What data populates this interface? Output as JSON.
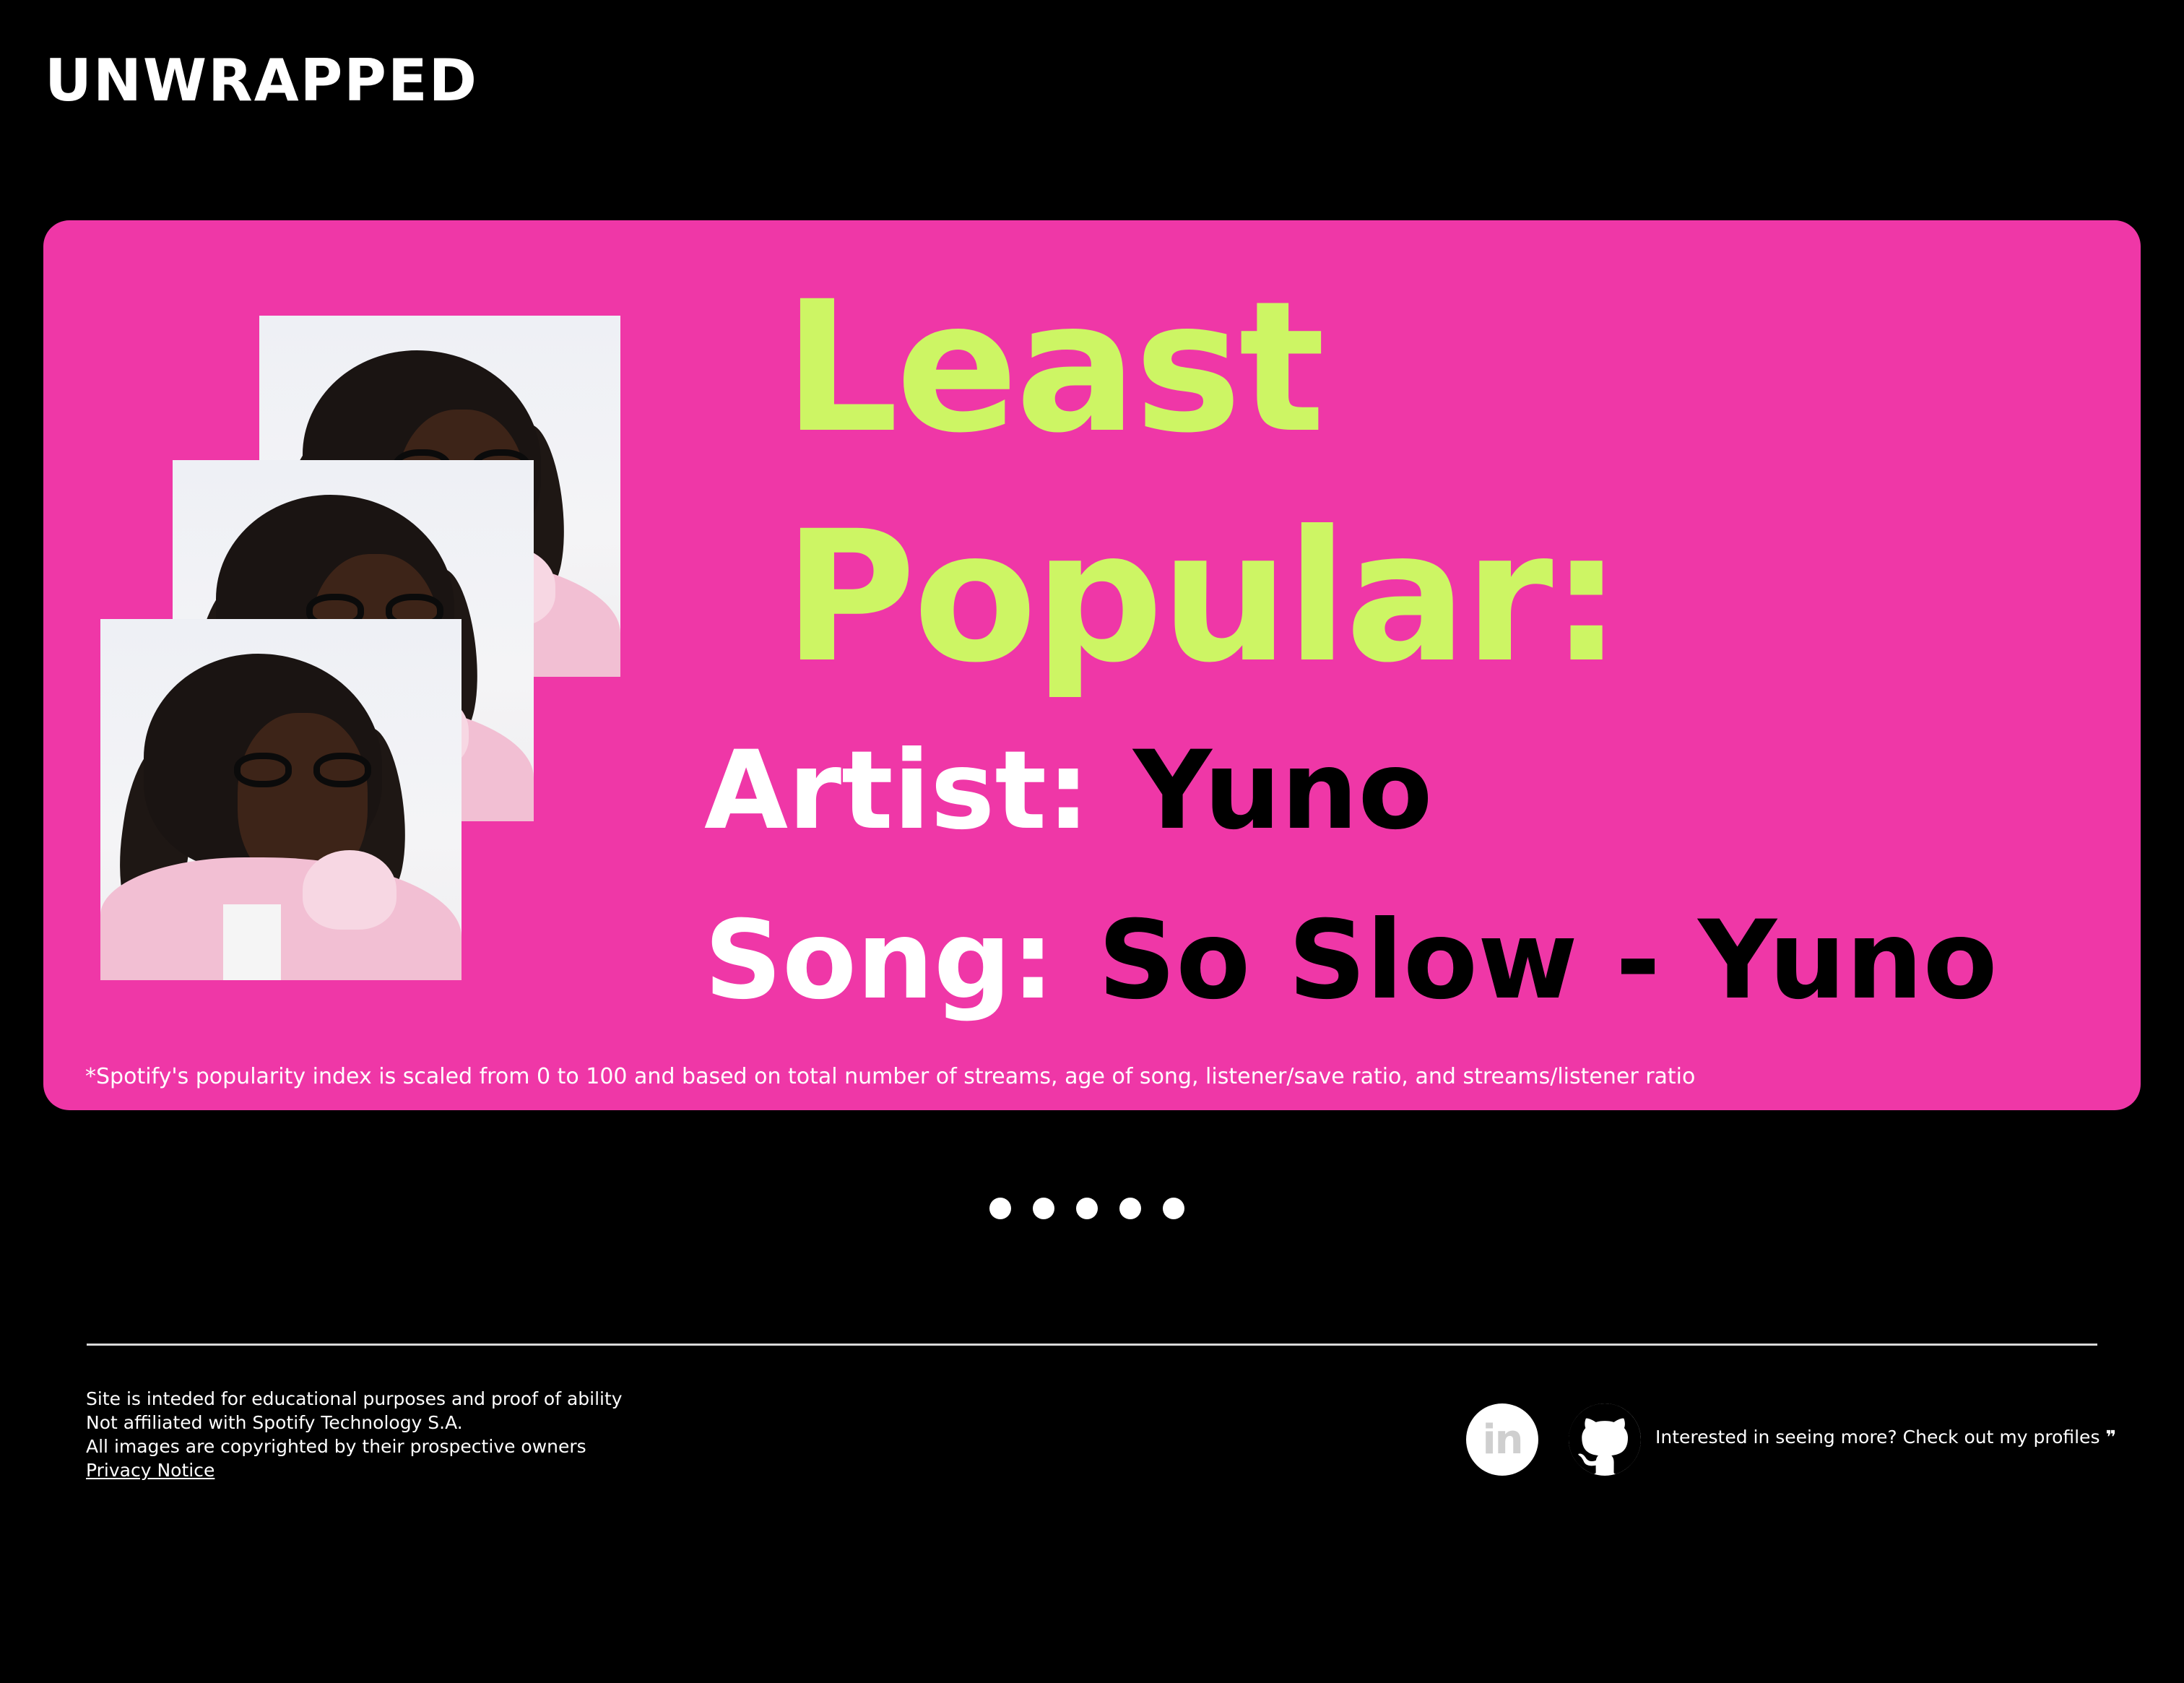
{
  "header": {
    "brand": "UNWRAPPED"
  },
  "card": {
    "background_color": "#ef37a7",
    "heading_color": "#cdf564",
    "heading_line1": "Least",
    "heading_line2": "Popular:",
    "artist_label": "Artist:",
    "artist_value": "Yuno",
    "song_label": "Song:",
    "song_value": "So Slow - Yuno",
    "footnote": "*Spotify's popularity index is scaled from 0 to 100 and based on total number of streams, age of song, listener/save ratio, and streams/listener ratio",
    "images": [
      {
        "icon": "album-art-image"
      },
      {
        "icon": "album-art-image"
      },
      {
        "icon": "album-art-image"
      }
    ]
  },
  "pagination": {
    "count": 5
  },
  "footer": {
    "lines": [
      "Site is inteded for educational purposes and proof of ability",
      "Not affiliated with Spotify Technology S.A.",
      "All images are copyrighted by their prospective owners"
    ],
    "privacy_link": "Privacy Notice",
    "linkedin_icon_text": "in",
    "profiles_text": "Interested in seeing more? Check out my profiles",
    "quote_glyph": "❞"
  }
}
